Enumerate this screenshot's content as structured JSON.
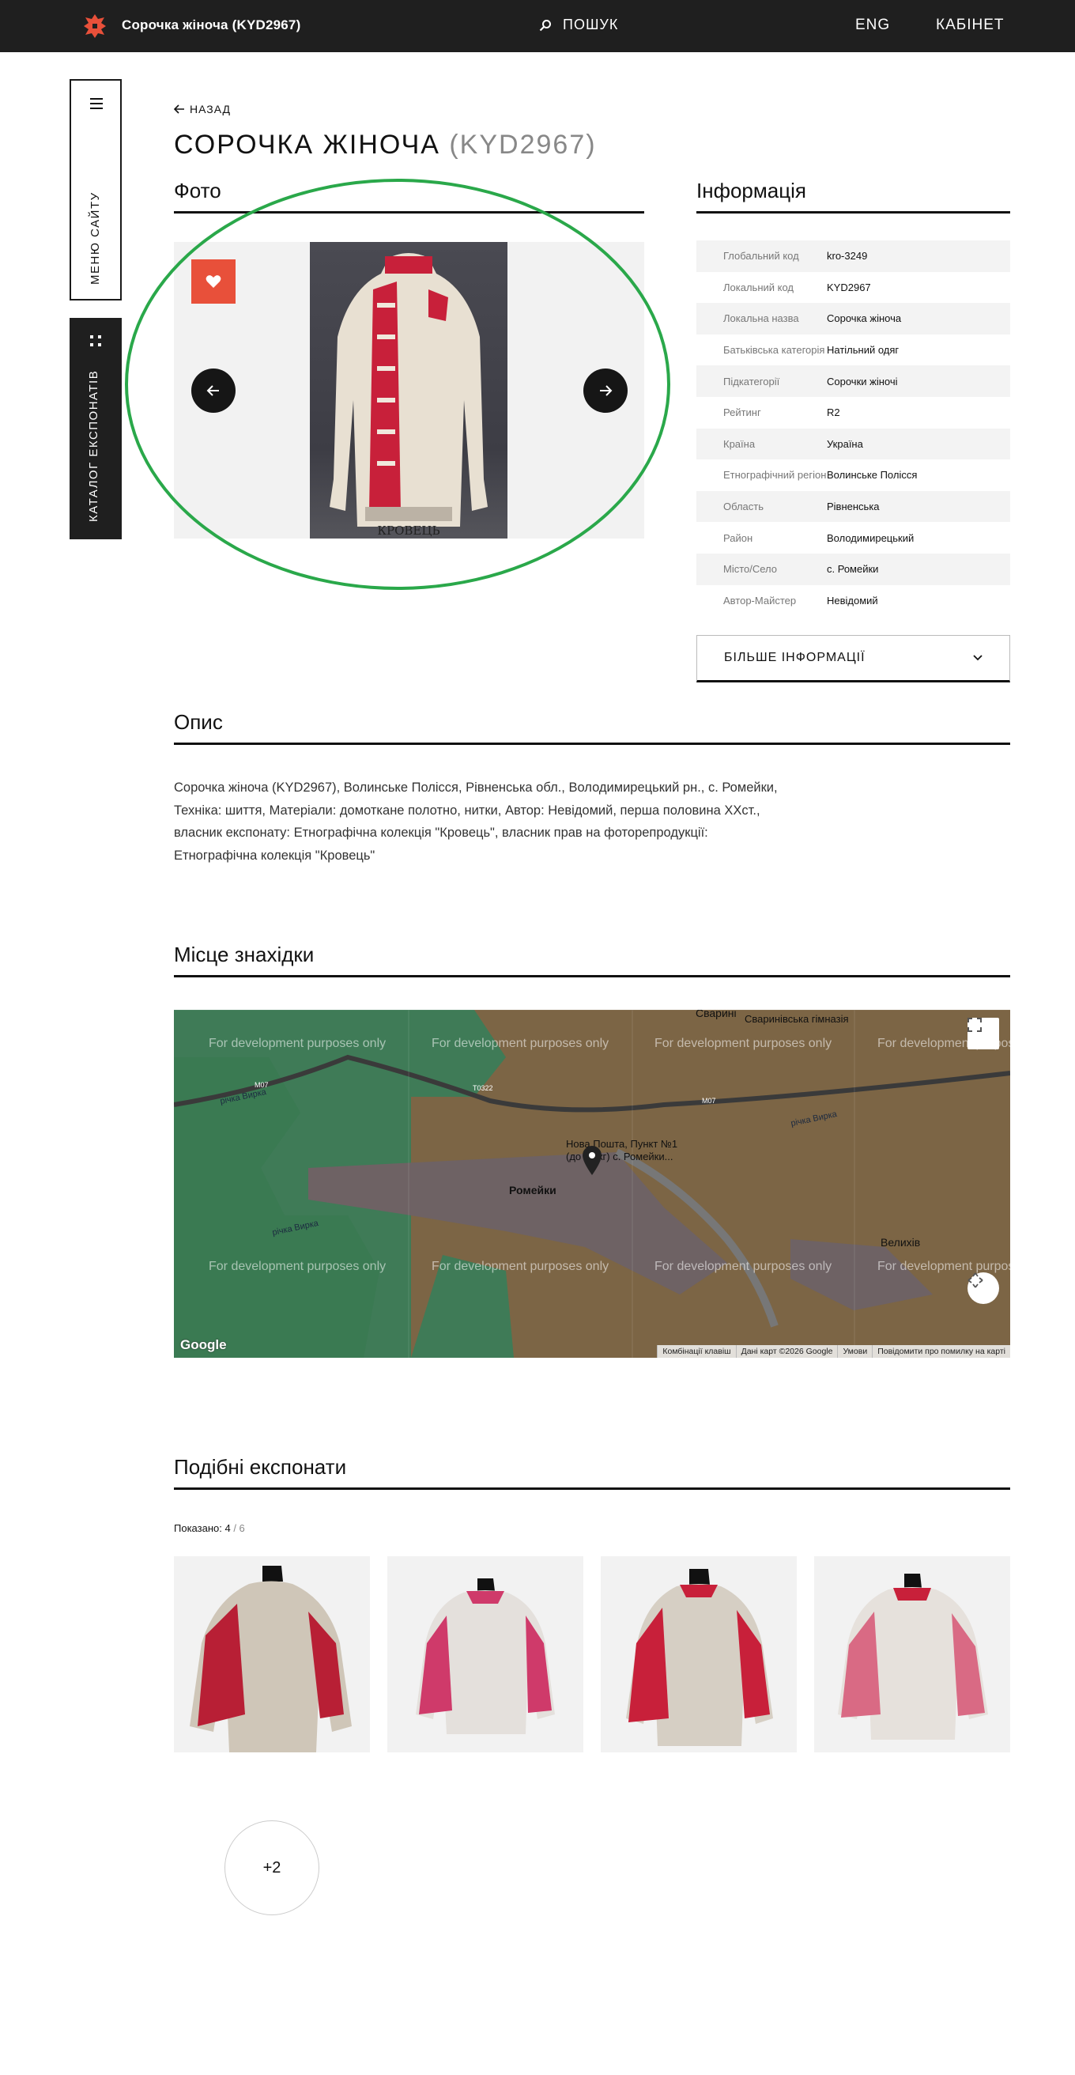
{
  "header": {
    "site_title": "Сорочка жіноча (KYD2967)",
    "search_label": "ПОШУК",
    "lang_label": "ENG",
    "cabinet_label": "КАБІНЕТ"
  },
  "rail": {
    "menu_label": "МЕНЮ САЙТУ",
    "catalog_label": "КАТАЛОГ ЕКСПОНАТІВ"
  },
  "page": {
    "back_label": "НАЗАД",
    "title": "СОРОЧКА ЖІНОЧА",
    "title_code": "(KYD2967)"
  },
  "sections": {
    "photo": "Фото",
    "info": "Інформація",
    "description": "Опис",
    "location": "Місце знахідки",
    "similar": "Подібні експонати"
  },
  "photo_watermark": "КРОВЕЦЬ",
  "info": [
    {
      "key": "Глобальний код",
      "value": "kro-3249"
    },
    {
      "key": "Локальний код",
      "value": "KYD2967"
    },
    {
      "key": "Локальна назва",
      "value": "Сорочка жіноча"
    },
    {
      "key": "Батьківська категорія",
      "value": "Натільний одяг"
    },
    {
      "key": "Підкатегорії",
      "value": "Сорочки жіночі"
    },
    {
      "key": "Рейтинг",
      "value": "R2"
    },
    {
      "key": "Країна",
      "value": "Україна"
    },
    {
      "key": "Етнографічний регіон",
      "value": "Волинське Полісся"
    },
    {
      "key": "Область",
      "value": "Рівненська"
    },
    {
      "key": "Район",
      "value": "Володимирецький"
    },
    {
      "key": "Місто/Село",
      "value": "с. Ромейки"
    },
    {
      "key": "Автор-Майстер",
      "value": "Невідомий"
    }
  ],
  "more_info_label": "БІЛЬШЕ ІНФОРМАЦІЇ",
  "description": {
    "line1": "Сорочка жіноча (KYD2967), Волинське Полісся, Рівненська обл., Володимирецький рн., с. Ромейки,",
    "line2": "Техніка: шиття, Матеріали: домоткане полотно, нитки, Автор: Невідомий, перша половина ХХст.,",
    "line3": "власник експонату: Етнографічна колекція \"Кровець\", власник прав на фоторепродукції:",
    "line4": "Етнографічна колекція \"Кровець\""
  },
  "map": {
    "dev_text": "For development purposes only",
    "place_romeiky": "Ромейки",
    "place_velykhiv": "Велихів",
    "place_svaryni": "Сварині",
    "poi_gymnasium": "Сваринівська гімназія",
    "poi_post_1": "Нова Пошта, Пункт №1",
    "poi_post_2": "(до 30 кг) с. Ромейки...",
    "river_1": "річка Вирка",
    "river_2": "річка Вирка",
    "river_3": "річка Вирка",
    "road_m07": "M07",
    "road_t0322": "T0322",
    "google": "Google",
    "attrib_keys": "Комбінації клавіш",
    "attrib_data": "Дані карт ©2026 Google",
    "attrib_terms": "Умови",
    "attrib_report": "Повідомити про помилку на карті"
  },
  "similar": {
    "shown_prefix": "Показано:",
    "shown_count": "4",
    "shown_total": "/ 6",
    "more_count": "+2"
  },
  "colors": {
    "topbar": "#1f1f1f",
    "accent": "#e8503a",
    "highlight_ellipse": "#2aa84a",
    "embroidery": "#c8203a"
  }
}
